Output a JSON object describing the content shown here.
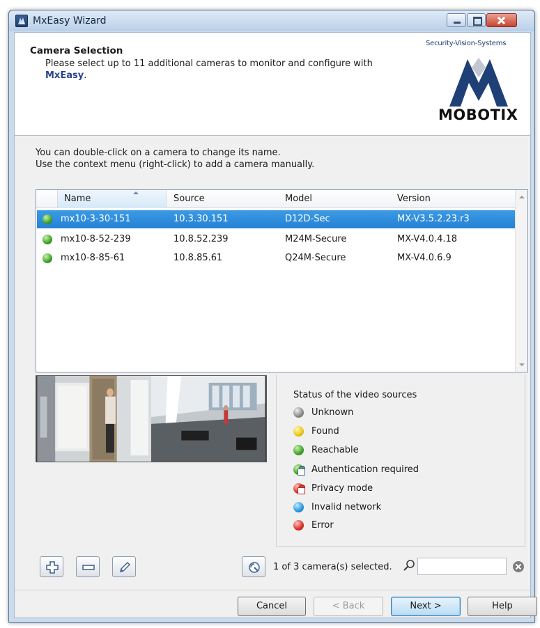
{
  "window": {
    "title": "MxEasy Wizard"
  },
  "header": {
    "title": "Camera Selection",
    "description_prefix": "Please select up to 11 additional cameras to monitor and configure with",
    "description_brand": "MxEasy",
    "description_suffix": ".",
    "logo_tagline": "Security-Vision-Systems",
    "logo_word": "MOBOTIX"
  },
  "instructions": {
    "line1": "You can double-click on a camera to change its name.",
    "line2": "Use the context menu (right-click) to add a camera manually."
  },
  "table": {
    "columns": [
      "Name",
      "Source",
      "Model",
      "Version"
    ],
    "rows": [
      {
        "status": "reachable",
        "name": "mx10-3-30-151",
        "source": "10.3.30.151",
        "model": "D12D-Sec",
        "version": "MX-V3.5.2.23.r3",
        "selected": true
      },
      {
        "status": "reachable",
        "name": "mx10-8-52-239",
        "source": "10.8.52.239",
        "model": "M24M-Secure",
        "version": "MX-V4.0.4.18",
        "selected": false
      },
      {
        "status": "reachable",
        "name": "mx10-8-85-61",
        "source": "10.8.85.61",
        "model": "Q24M-Secure",
        "version": "MX-V4.0.6.9",
        "selected": false
      }
    ]
  },
  "status_legend": {
    "title": "Status of the video sources",
    "items": [
      {
        "label": "Unknown",
        "icon": "grey-dot-icon",
        "color": "#8a8a8a"
      },
      {
        "label": "Found",
        "icon": "yellow-dot-icon",
        "color": "#ecc51a"
      },
      {
        "label": "Reachable",
        "icon": "green-dot-icon",
        "color": "#3fa22a"
      },
      {
        "label": "Authentication required",
        "icon": "green-lock-icon",
        "color": "#3fa22a"
      },
      {
        "label": "Privacy mode",
        "icon": "red-lock-icon",
        "color": "#d92e25"
      },
      {
        "label": "Invalid network",
        "icon": "blue-dot-icon",
        "color": "#2a98dc"
      },
      {
        "label": "Error",
        "icon": "red-dot-icon",
        "color": "#d92e25"
      }
    ]
  },
  "toolbar": {
    "add_icon": "plus-icon",
    "remove_icon": "minus-icon",
    "edit_icon": "pencil-icon",
    "scan_icon": "network-scan-icon",
    "selected_text": "1 of 3 camera(s) selected.",
    "search_value": ""
  },
  "buttons": {
    "cancel": "Cancel",
    "back": "< Back",
    "next": "Next >",
    "help": "Help"
  },
  "colors": {
    "selection": "#2a86d6",
    "brand_blue": "#27458a"
  }
}
